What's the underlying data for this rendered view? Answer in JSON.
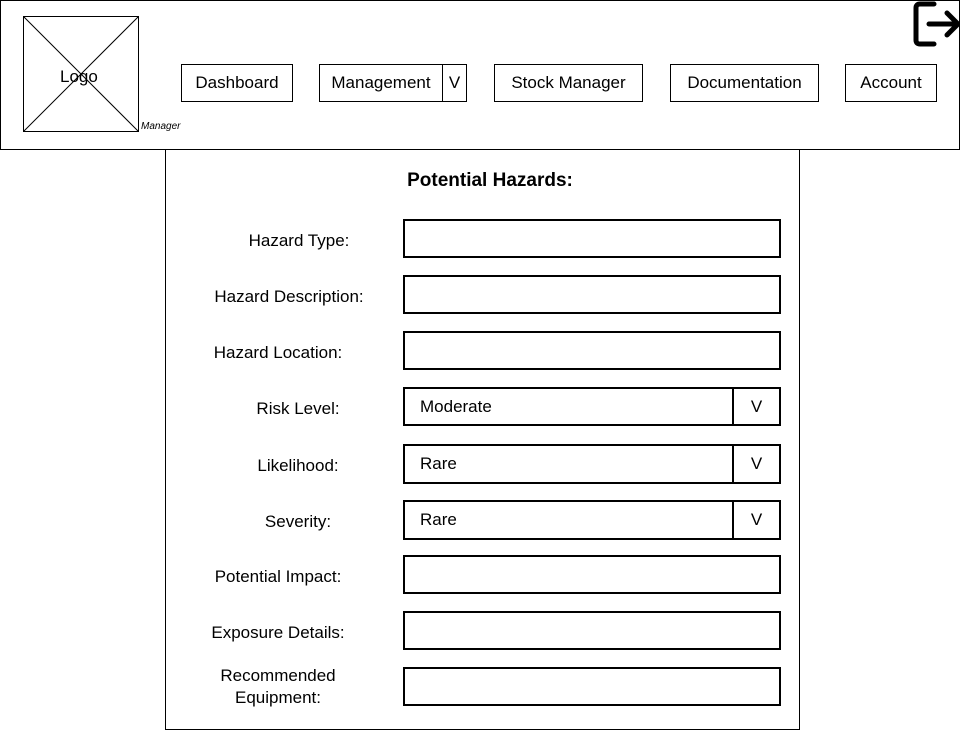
{
  "header": {
    "logo_label": "Logo",
    "role_label": "Manager",
    "nav": {
      "dashboard": "Dashboard",
      "management": "Management",
      "management_caret": "V",
      "stock_manager": "Stock Manager",
      "documentation": "Documentation",
      "account": "Account"
    }
  },
  "form": {
    "title": "Potential Hazards:",
    "fields": {
      "hazard_type": {
        "label": "Hazard Type:",
        "value": ""
      },
      "hazard_description": {
        "label": "Hazard Description:",
        "value": ""
      },
      "hazard_location": {
        "label": "Hazard Location:",
        "value": ""
      },
      "risk_level": {
        "label": "Risk Level:",
        "value": "Moderate",
        "caret": "V"
      },
      "likelihood": {
        "label": "Likelihood:",
        "value": "Rare",
        "caret": "V"
      },
      "severity": {
        "label": "Severity:",
        "value": "Rare",
        "caret": "V"
      },
      "potential_impact": {
        "label": "Potential Impact:",
        "value": ""
      },
      "exposure_details": {
        "label": "Exposure Details:",
        "value": ""
      },
      "recommended_equipment": {
        "label": "Recommended Equipment:",
        "value": ""
      }
    }
  }
}
